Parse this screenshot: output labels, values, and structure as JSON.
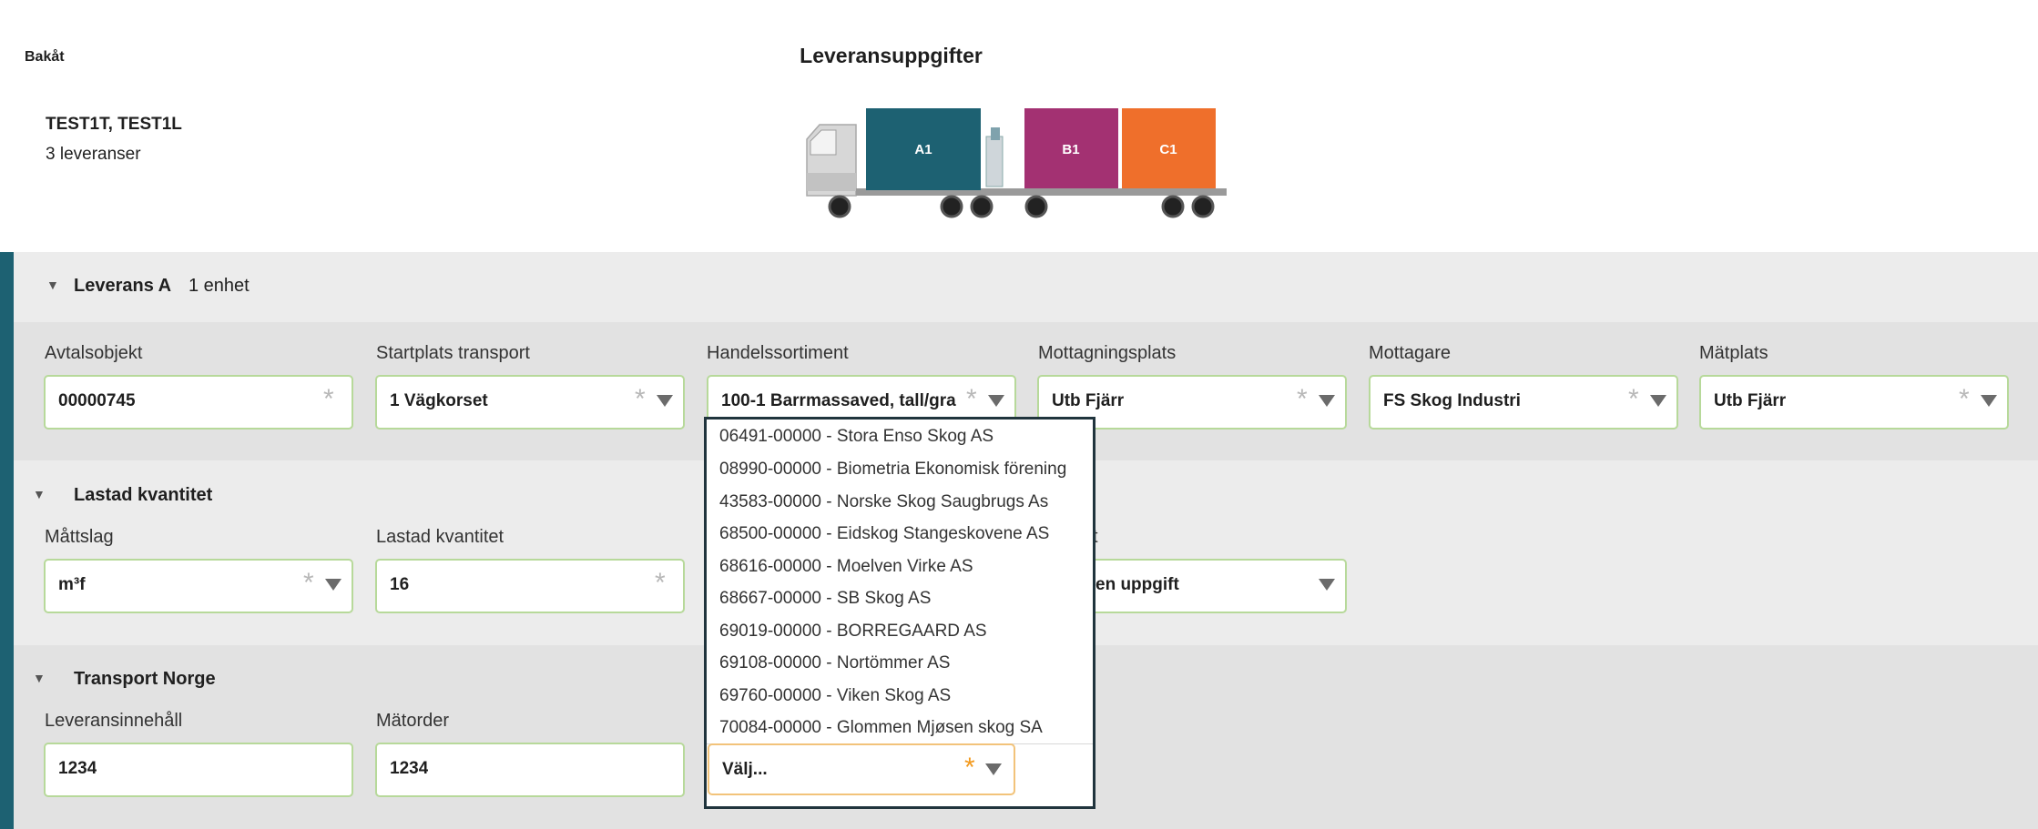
{
  "header": {
    "back_label": "Bakåt",
    "title": "Leveransuppgifter",
    "vehicle_name": "TEST1T, TEST1L",
    "delivery_count": "3 leveranser"
  },
  "truck": {
    "containers": [
      {
        "label": "A1",
        "color": "#1d6172"
      },
      {
        "label": "B1",
        "color": "#a33172"
      },
      {
        "label": "C1",
        "color": "#ef6f2b"
      }
    ]
  },
  "sections": {
    "leverans_a": {
      "title": "Leverans A",
      "subtitle": "1 enhet",
      "fields": {
        "avtalsobjekt": {
          "label": "Avtalsobjekt",
          "value": "00000745"
        },
        "startplats": {
          "label": "Startplats transport",
          "value": "1 Vägkorset"
        },
        "handelssortiment": {
          "label": "Handelssortiment",
          "value": "100-1 Barrmassaved, tall/gra"
        },
        "mottagningsplats": {
          "label": "Mottagningsplats",
          "value": "Utb Fjärr"
        },
        "mottagare": {
          "label": "Mottagare",
          "value": "FS Skog Industri"
        },
        "matplats": {
          "label": "Mätplats",
          "value": "Utb Fjärr"
        }
      }
    },
    "lastad_kvantitet": {
      "title": "Lastad kvantitet",
      "fields": {
        "mattslag": {
          "label": "Måttslag",
          "value": "m³f"
        },
        "lastad": {
          "label": "Lastad kvantitet",
          "value": "16"
        },
        "hidden_label_tail": "t",
        "hidden_value_tail": "en uppgift"
      }
    },
    "transport_norge": {
      "title": "Transport Norge",
      "fields": {
        "leveransinnehall": {
          "label": "Leveransinnehåll",
          "value": "1234"
        },
        "matorder": {
          "label": "Mätorder",
          "value": "1234"
        },
        "select": {
          "value": "Välj..."
        }
      }
    }
  },
  "dropdown": {
    "options": [
      "06491-00000 - Stora Enso Skog AS",
      "08990-00000 - Biometria Ekonomisk förening",
      "43583-00000 - Norske Skog Saugbrugs As",
      "68500-00000 - Eidskog Stangeskovene AS",
      "68616-00000 - Moelven Virke AS",
      "68667-00000 - SB Skog AS",
      "69019-00000 - BORREGAARD AS",
      "69108-00000 - Nortömmer AS",
      "69760-00000 - Viken Skog AS",
      "70084-00000 - Glommen Mjøsen skog SA"
    ]
  }
}
